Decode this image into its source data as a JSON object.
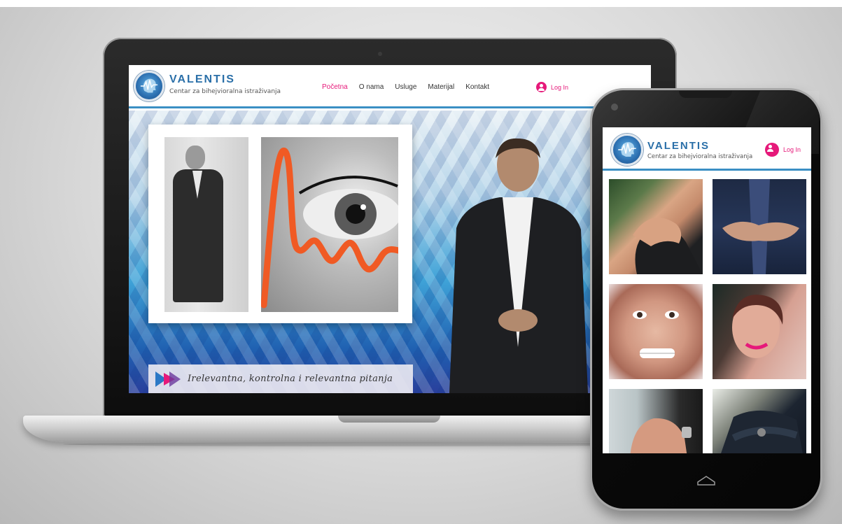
{
  "brand": {
    "name": "VALENTIS",
    "tagline": "Centar za bihejvioralna istraživanja",
    "accent_color": "#e6197a",
    "brand_color": "#2a6fa8",
    "header_line_color": "#3a8fc4"
  },
  "laptop": {
    "nav": [
      "Početna",
      "O nama",
      "Usluge",
      "Materijal",
      "Kontakt"
    ],
    "active_nav": "Početna",
    "login_label": "Log In",
    "caption": "Irelevantna, kontrolna i relevantna pitanja"
  },
  "phone": {
    "login_label": "Log In",
    "tiles": [
      {
        "icon": "chin-hand-photo"
      },
      {
        "icon": "clasped-hands-photo"
      },
      {
        "icon": "grimace-face-photo"
      },
      {
        "icon": "smiling-woman-photo"
      },
      {
        "icon": "hands-on-table-photo"
      },
      {
        "icon": "crossed-arms-photo"
      }
    ]
  }
}
